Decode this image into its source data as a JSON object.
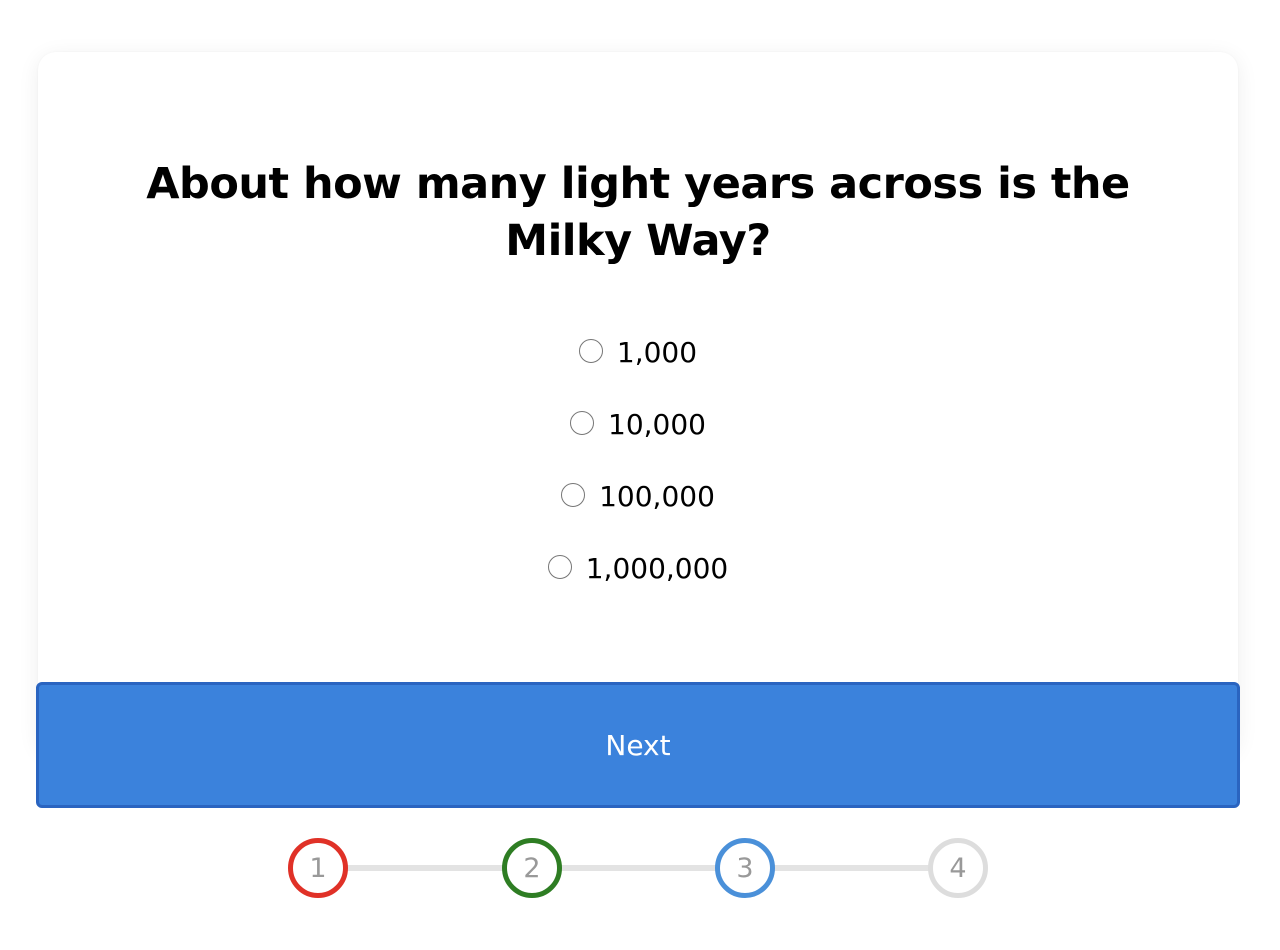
{
  "question": {
    "text": "About how many light years across is the Milky Way?"
  },
  "options": [
    {
      "label": "1,000",
      "selected": false
    },
    {
      "label": "10,000",
      "selected": false
    },
    {
      "label": "100,000",
      "selected": false
    },
    {
      "label": "1,000,000",
      "selected": false
    }
  ],
  "next_button": {
    "label": "Next",
    "color": "#3b82dc",
    "border_color": "#2a64c0"
  },
  "stepper": {
    "steps": [
      {
        "label": "1",
        "color": "#e03127"
      },
      {
        "label": "2",
        "color": "#2e7d23"
      },
      {
        "label": "3",
        "color": "#4a90d9"
      },
      {
        "label": "4",
        "color": "#dddddd"
      }
    ],
    "line_color": "#e3e3e3"
  }
}
